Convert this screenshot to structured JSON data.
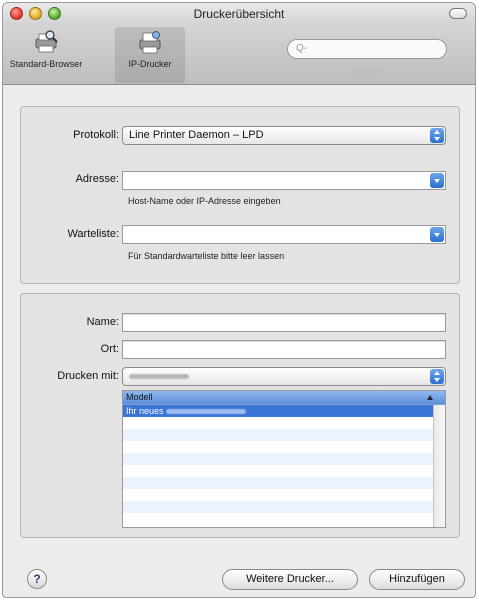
{
  "window": {
    "title": "Druckerübersicht"
  },
  "toolbar": {
    "items": [
      {
        "label": "Standard-Browser",
        "icon": "printer-magnifier-icon"
      },
      {
        "label": "IP-Drucker",
        "icon": "network-printer-icon",
        "selected": true
      }
    ],
    "search": {
      "placeholder": "Q-",
      "label": "Suchen"
    }
  },
  "connection": {
    "protocol_label": "Protokoll:",
    "protocol_value": "Line Printer Daemon – LPD",
    "address_label": "Adresse:",
    "address_value": "",
    "address_hint": "Host-Name oder IP-Adresse eingeben",
    "queue_label": "Warteliste:",
    "queue_value": "",
    "queue_hint": "Für Standardwarteliste bitte leer lassen"
  },
  "printer": {
    "name_label": "Name:",
    "name_value": "",
    "location_label": "Ort:",
    "location_value": "",
    "print_using_label": "Drucken mit:",
    "print_using_value_redacted": true,
    "model_list": {
      "header": "Modell",
      "sort": "ascending",
      "rows": [
        {
          "prefix": "Ihr neues",
          "redacted": true,
          "selected": true
        }
      ]
    }
  },
  "footer": {
    "help_label": "?",
    "more_printers_label": "Weitere Drucker...",
    "add_label": "Hinzufügen"
  },
  "colors": {
    "selection": "#3875d7",
    "popup_arrow": "#2a6fd0",
    "window_bg": "#ececec"
  }
}
